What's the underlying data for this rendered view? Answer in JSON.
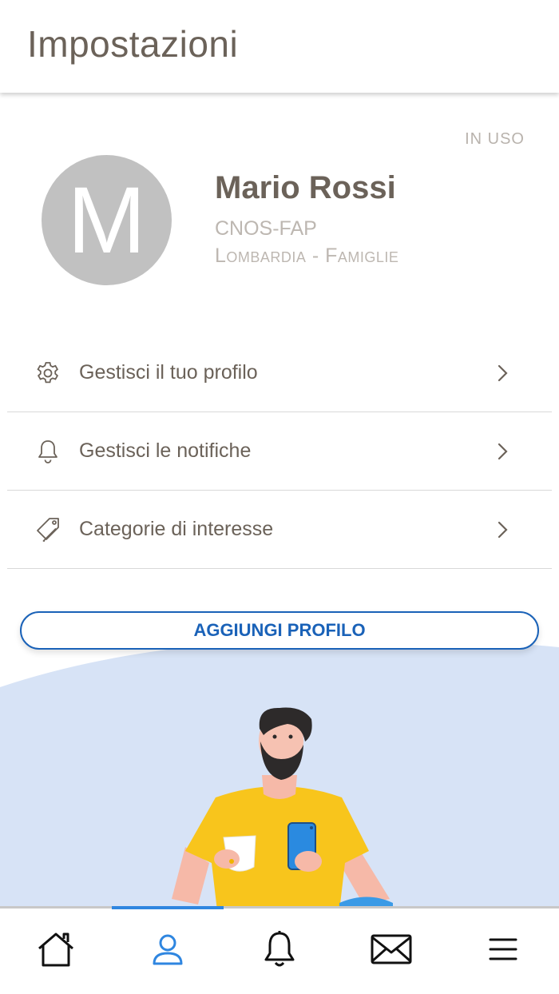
{
  "header": {
    "title": "Impostazioni"
  },
  "profile": {
    "status": "IN USO",
    "avatar_letter": "M",
    "name": "Mario Rossi",
    "organization": "CNOS-FAP",
    "region": "Lombardia - Famiglie"
  },
  "menu": {
    "items": [
      {
        "label": "Gestisci il tuo profilo",
        "icon": "gear-icon"
      },
      {
        "label": "Gestisci le notifiche",
        "icon": "bell-icon"
      },
      {
        "label": "Categorie di interesse",
        "icon": "tags-icon"
      }
    ]
  },
  "add_profile_button": "AGGIUNGI PROFILO",
  "tabbar": {
    "active_index": 1,
    "active_color": "#2f86e0",
    "tabs": [
      "home-icon",
      "user-icon",
      "bell-icon",
      "mail-icon",
      "menu-icon"
    ]
  },
  "colors": {
    "accent": "#1a62b8",
    "illustration_bg": "#d7e3f6",
    "shirt": "#f8c51c",
    "phone": "#2a8ae0"
  }
}
